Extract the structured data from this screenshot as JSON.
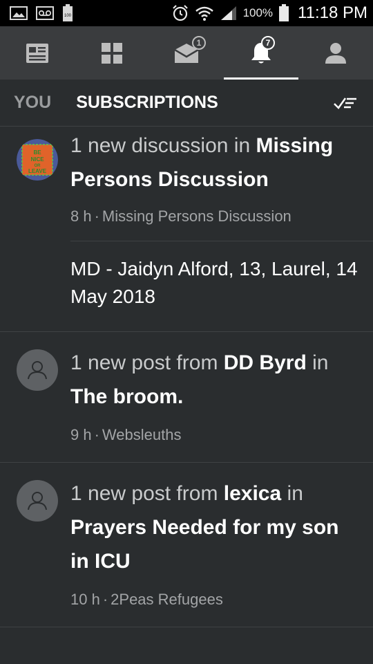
{
  "status_bar": {
    "battery_percent": "100%",
    "time": "11:18 PM"
  },
  "topnav": {
    "tabs": [
      {
        "icon": "news-feed-icon",
        "badge": ""
      },
      {
        "icon": "grid-icon",
        "badge": ""
      },
      {
        "icon": "inbox-icon",
        "badge": "1"
      },
      {
        "icon": "bell-icon",
        "badge": "7"
      },
      {
        "icon": "profile-icon",
        "badge": ""
      }
    ]
  },
  "subtabs": {
    "you": "YOU",
    "subscriptions": "SUBSCRIPTIONS"
  },
  "feed": [
    {
      "prefix": "1 new discussion in ",
      "bold": "Missing Persons Discussion",
      "time": "8 h",
      "source": "Missing Persons Discussion",
      "subitem": "MD - Jaidyn Alford, 13, Laurel, 14 May 2018",
      "avatar_text": "BE NICE OR LEAVE"
    },
    {
      "prefix": "1 new post from ",
      "user": "DD Byrd",
      "mid": " in ",
      "thread": "The broom.",
      "time": "9 h",
      "source": "Websleuths"
    },
    {
      "prefix": "1 new post from ",
      "user": "lexica",
      "mid": " in ",
      "thread": "Prayers Needed for my son in ICU",
      "time": "10 h",
      "source": "2Peas Refugees"
    }
  ],
  "colors": {
    "background": "#2a2d2f",
    "nav": "#3a3c3e",
    "status": "#000000"
  }
}
